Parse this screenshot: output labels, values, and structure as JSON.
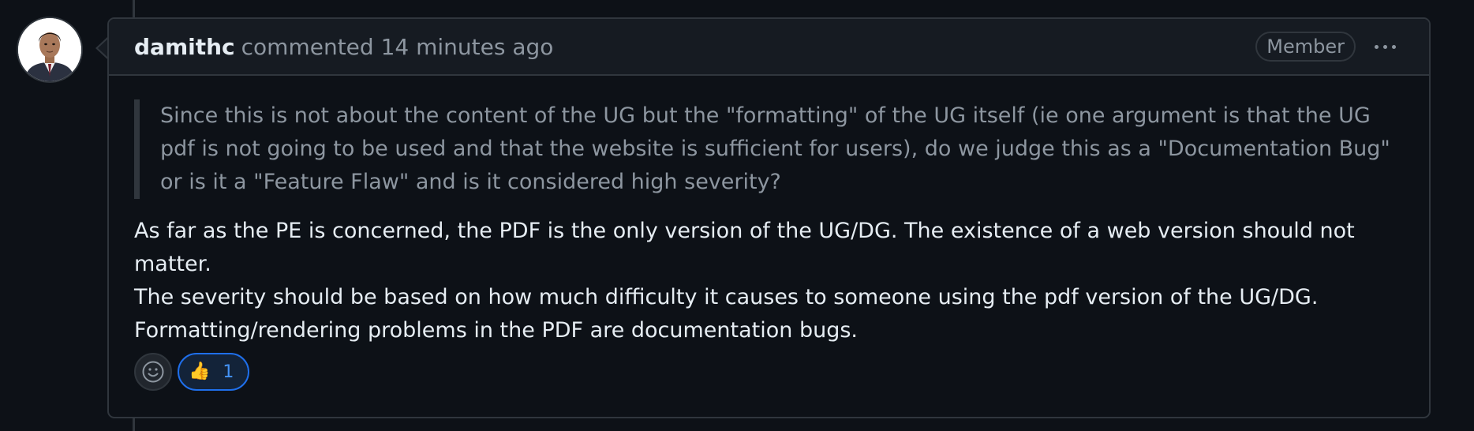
{
  "comment": {
    "author": "damithc",
    "meta": "commented 14 minutes ago",
    "role_badge": "Member",
    "quote": "Since this is not about the content of the UG but the \"formatting\" of the UG itself (ie one argument is that the UG pdf is not going to be used and that the website is sufficient for users), do we judge this as a \"Documentation Bug\" or is it a \"Feature Flaw\" and is it considered high severity?",
    "reply_lines": [
      "As far as the PE is concerned, the PDF is the only version of the UG/DG. The existence of a web version should not matter.",
      "The severity should be based on how much difficulty it causes to someone using the pdf version of the UG/DG.",
      "Formatting/rendering problems in the PDF are documentation bugs."
    ],
    "reactions": [
      {
        "icon": "thumbs-up-icon",
        "emoji": "👍",
        "count": "1"
      }
    ]
  },
  "colors": {
    "background": "#0d1117",
    "header_bg": "#161b22",
    "border": "#30363d",
    "text_primary": "#e6edf3",
    "text_muted": "#8d96a0",
    "accent": "#1f6feb",
    "accent_text": "#4493f8"
  },
  "icons": {
    "avatar": "user-avatar",
    "options": "kebab-horizontal-icon",
    "add_reaction": "smiley-icon"
  }
}
